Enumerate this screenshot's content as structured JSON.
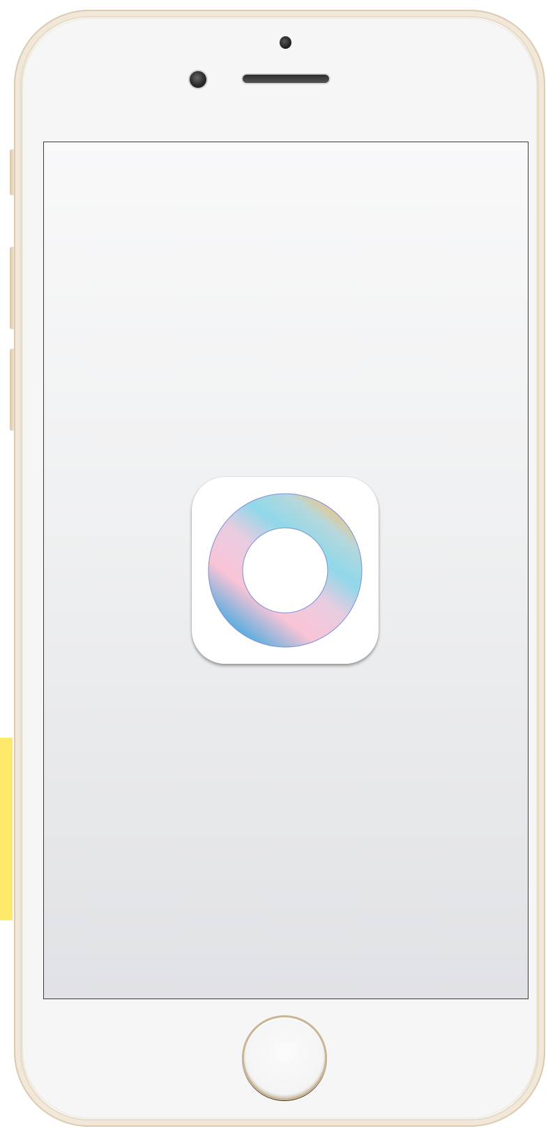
{
  "device": {
    "model": "iphone",
    "finish": "gold",
    "accent_color": "#ffe96a",
    "body_color": "#f6efe3"
  },
  "screen": {
    "background_top": "#f9f9fa",
    "background_bottom": "#e1e2e5"
  },
  "app_icon": {
    "icon": "gradient-ring-icon",
    "gradient_colors": [
      "#2fa8e0",
      "#f9c4d6",
      "#8fd8ea",
      "#fcc06a"
    ]
  },
  "home_button": {
    "icon": "home-button"
  }
}
